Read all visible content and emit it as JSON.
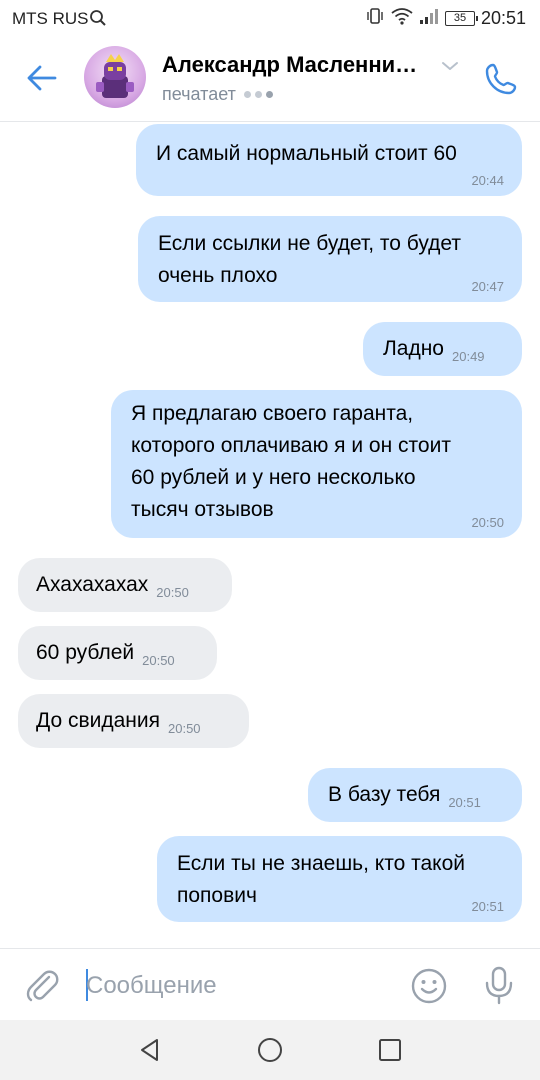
{
  "status_bar": {
    "carrier": "MTS RUS",
    "battery": "35",
    "time": "20:51"
  },
  "header": {
    "contact_name": "Александр Масленни…",
    "status": "печатает"
  },
  "messages": [
    {
      "direction": "out",
      "text": "И самый нормальный стоит 60",
      "time": "20:44"
    },
    {
      "direction": "out",
      "text": "Если ссылки не будет, то будет\nочень плохо",
      "time": "20:47"
    },
    {
      "direction": "out",
      "text": "Ладно",
      "time": "20:49"
    },
    {
      "direction": "out",
      "text": "Я предлагаю своего гаранта,\nкоторого оплачиваю я и он стоит\n60 рублей и у него несколько\nтысяч отзывов",
      "time": "20:50"
    },
    {
      "direction": "in",
      "text": "Ахахахахах",
      "time": "20:50"
    },
    {
      "direction": "in",
      "text": "60 рублей",
      "time": "20:50"
    },
    {
      "direction": "in",
      "text": "До свидания",
      "time": "20:50"
    },
    {
      "direction": "out",
      "text": "В базу тебя",
      "time": "20:51"
    },
    {
      "direction": "out",
      "text": "Если ты не знаешь, кто такой\nпопович",
      "time": "20:51"
    }
  ],
  "composer": {
    "placeholder": "Сообщение"
  },
  "icons": {
    "back": "arrow-left-icon",
    "call": "phone-icon",
    "attach": "paperclip-icon",
    "emoji": "smile-icon",
    "mic": "microphone-icon"
  },
  "colors": {
    "accent": "#3f8ae0",
    "outgoing_bubble": "#cce4ff",
    "incoming_bubble": "#ebedf0",
    "secondary_text": "#818c99"
  }
}
